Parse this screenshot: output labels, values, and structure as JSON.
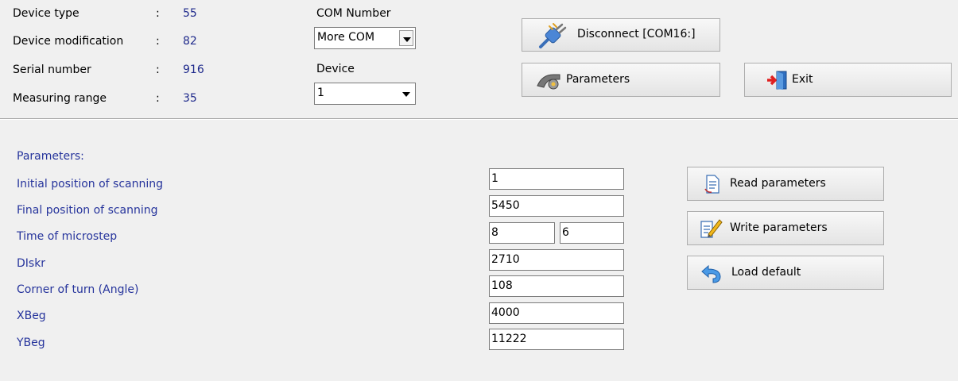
{
  "device_info": [
    {
      "label": "Device type",
      "colon": ":",
      "value": "55"
    },
    {
      "label": "Device modification",
      "colon": ":",
      "value": "82"
    },
    {
      "label": "Serial number",
      "colon": ":",
      "value": "916"
    },
    {
      "label": "Measuring range",
      "colon": ":",
      "value": "35"
    }
  ],
  "com": {
    "label": "COM Number",
    "value": "More COM"
  },
  "device": {
    "label": "Device",
    "value": "1"
  },
  "buttons": {
    "disconnect": "Disconnect [COM16:]",
    "parameters": "Parameters",
    "exit": "Exit",
    "read": "Read parameters",
    "write": "Write parameters",
    "load": "Load default"
  },
  "params": {
    "heading": "Parameters:",
    "rows": [
      {
        "label": "Initial position of scanning",
        "value": "1"
      },
      {
        "label": "Final position of scanning",
        "value": "5450"
      },
      {
        "label": "Time of microstep",
        "value": "8",
        "value2": "6"
      },
      {
        "label": "DIskr",
        "value": "2710"
      },
      {
        "label": "Corner of turn (Angle)",
        "value": "108"
      },
      {
        "label": "XBeg",
        "value": "4000"
      },
      {
        "label": "YBeg",
        "value": "11222"
      }
    ]
  },
  "colors": {
    "label_blue": "#26349c",
    "value_blue": "#1f2a8c",
    "background": "#f0f0f0"
  },
  "icons": {
    "disconnect": "plug-icon",
    "parameters": "gear-icon",
    "exit": "exit-door-icon",
    "read": "document-icon",
    "write": "edit-document-icon",
    "load": "undo-arrow-icon"
  }
}
